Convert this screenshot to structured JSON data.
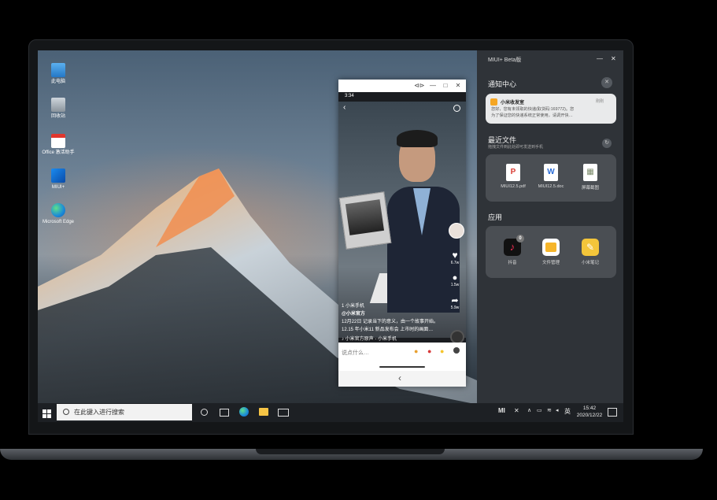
{
  "desktop": {
    "icons": [
      {
        "label": "此电脑",
        "icon": "computer-icon"
      },
      {
        "label": "回收站",
        "icon": "recycle-bin-icon"
      },
      {
        "label": "Office 激活助手",
        "icon": "pdf-icon"
      },
      {
        "label": "MIUI+",
        "icon": "miui-plus-icon"
      },
      {
        "label": "Microsoft Edge",
        "icon": "edge-icon"
      }
    ]
  },
  "phone_window": {
    "title_buttons": [
      "⊲⊳",
      "—",
      "□",
      "✕"
    ],
    "status_time": "3:34",
    "side_counts": [
      "6.7w",
      "1.5w",
      "5.9w"
    ],
    "caption_lines": [
      "1 小米手机",
      "@小米官方",
      "12月22日 记录当下的意义，由一个故事开始。",
      "12.15 年小米11 新品发布会 上市时的画面…",
      "♪ 小米官方原声 - 小米手机"
    ],
    "comment_placeholder": "说点什么…",
    "nav_back": "‹"
  },
  "miui_panel": {
    "title": "MIUI+ Beta版",
    "controls": [
      "—",
      "✕"
    ],
    "notification_center": {
      "heading": "通知中心",
      "card": {
        "app": "小米收发室",
        "time": "刚刚",
        "body_line1": "您好，您有未领取的快递(取货码:169772)。您",
        "body_line2": "为了保证您的快递系统正常使用，请调开快…"
      }
    },
    "recent_files": {
      "heading": "最近文件",
      "subtitle": "拖拽文件到此处即可发送到手机",
      "files": [
        {
          "name": "MIUI12.5.pdf",
          "glyph": "P",
          "color": "#d93b32"
        },
        {
          "name": "MIUI12.5.doc",
          "glyph": "W",
          "color": "#2b6cd6"
        },
        {
          "name": "屏幕截图",
          "glyph": "▦",
          "color": "#7a8a6a"
        }
      ]
    },
    "apps": {
      "heading": "应用",
      "items": [
        {
          "name": "抖音",
          "badge": "0",
          "color": "#111111"
        },
        {
          "name": "文件管理",
          "color": "#f6b52a"
        },
        {
          "name": "小米笔记",
          "color": "#f3c53a"
        }
      ]
    }
  },
  "taskbar": {
    "start_icon": "windows-icon",
    "search_placeholder": "在此键入进行搜索",
    "tray_lang": "英",
    "clock_time": "15:42",
    "clock_date": "2020/12/22",
    "mi_label": "MI"
  }
}
